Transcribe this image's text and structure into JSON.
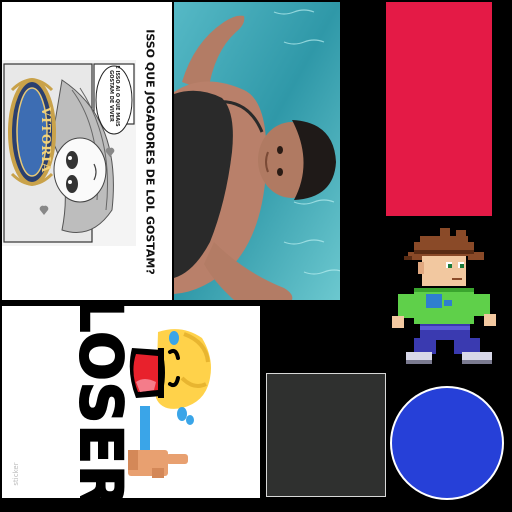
{
  "meme": {
    "title": "ISSO QUE JOGADORES DE LOL GOSTAM?",
    "bubble": "E ISSO AI O QUE MAIS GOSTAM DE VIVER",
    "badge": "VITORIA"
  },
  "loser_sticker": {
    "word": "LOSER",
    "watermark": "sticker"
  },
  "colors": {
    "red_rect": "#e41a46",
    "blue_circle": "#2640d8",
    "gray_rect": "#2f302f",
    "pool_water": "#3aa2b0",
    "boy_shirt": "#5fd04a",
    "boy_hair": "#8a4a28"
  },
  "icons": {
    "pixel_character": "pixel-boy-icon",
    "loser_hand": "l-hand-icon"
  }
}
